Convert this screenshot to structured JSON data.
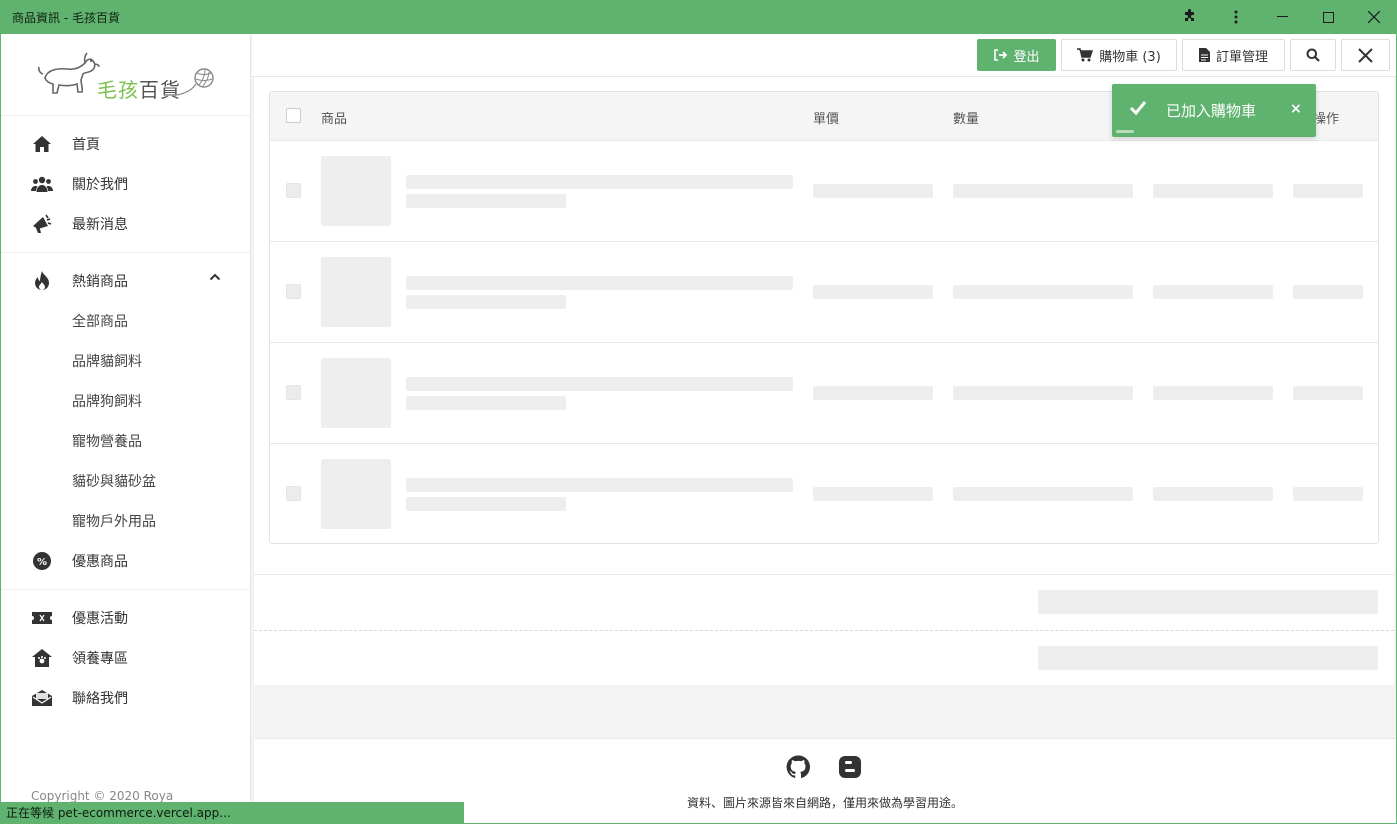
{
  "window": {
    "title": "商品資訊 - 毛孩百貨"
  },
  "logo": {
    "green": "毛孩",
    "dark": "百貨"
  },
  "sidebar": {
    "group1": [
      {
        "label": "首頁",
        "icon": "home-icon"
      },
      {
        "label": "關於我們",
        "icon": "users-icon"
      },
      {
        "label": "最新消息",
        "icon": "bullhorn-icon"
      }
    ],
    "group2": {
      "parent": {
        "label": "熱銷商品",
        "icon": "fire-icon"
      },
      "children": [
        "全部商品",
        "品牌貓飼料",
        "品牌狗飼料",
        "寵物營養品",
        "貓砂與貓砂盆",
        "寵物戶外用品"
      ],
      "extra": {
        "label": "優惠商品",
        "icon": "percent-badge-icon"
      }
    },
    "group3": [
      {
        "label": "優惠活動",
        "icon": "ticket-icon"
      },
      {
        "label": "領養專區",
        "icon": "paw-house-icon"
      },
      {
        "label": "聯絡我們",
        "icon": "envelope-open-icon"
      }
    ],
    "copyright": "Copyright © 2020 Roya"
  },
  "header": {
    "logout": "登出",
    "cart": "購物車 (3)",
    "orders": "訂單管理"
  },
  "table": {
    "columns": {
      "product": "商品",
      "price": "單價",
      "qty": "數量",
      "action": "操作"
    }
  },
  "toast": {
    "message": "已加入購物車",
    "close": "×"
  },
  "footer": {
    "note": "資料、圖片來源皆來自網路，僅用來做為學習用途。"
  },
  "status": {
    "text": "正在等候 pet-ecommerce.vercel.app..."
  },
  "colors": {
    "accent": "#5fb36f",
    "skeleton": "#eeeeee"
  }
}
